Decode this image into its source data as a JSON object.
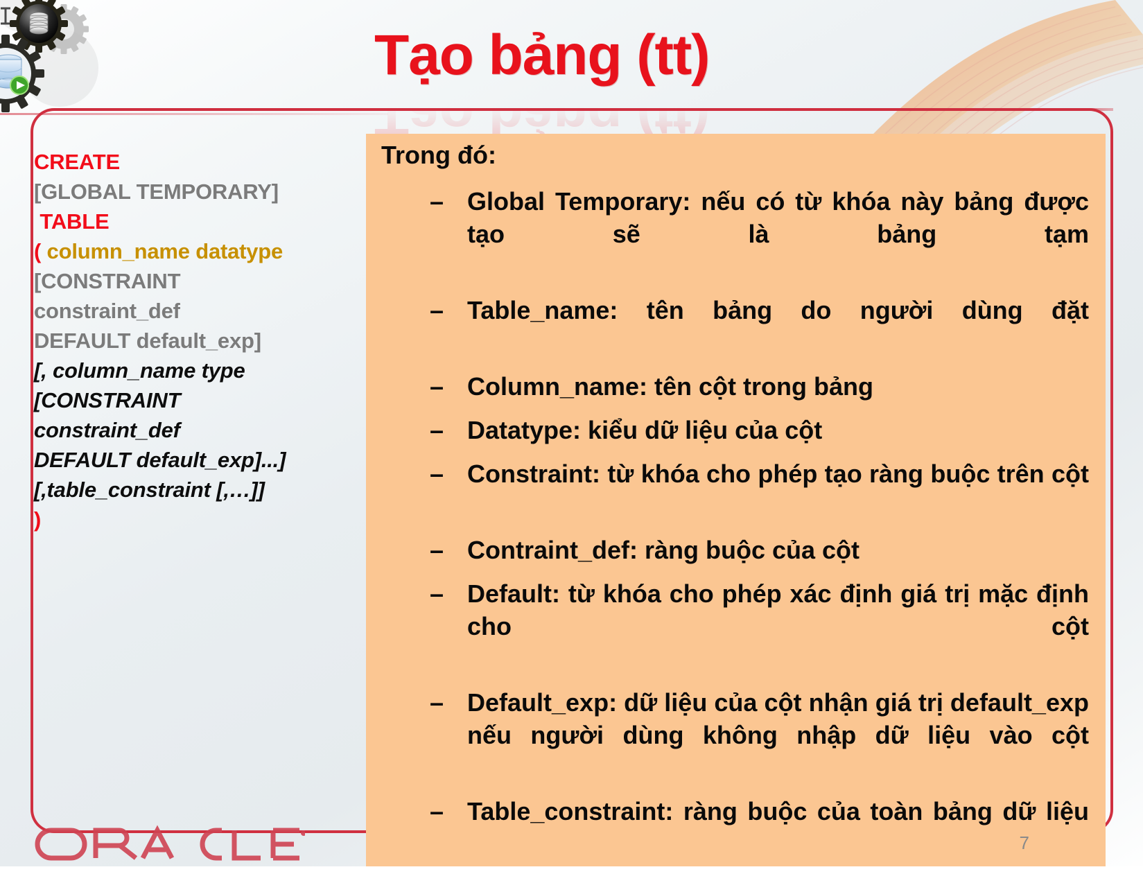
{
  "slide": {
    "title": "Tạo bảng (tt)",
    "page_number": "7",
    "brand_logo_text": "ORACLE",
    "colors": {
      "title_red": "#e8121c",
      "frame_red": "#d03040",
      "panel_orange": "#fbc692",
      "keyword_red": "#f20d1a",
      "optional_gray": "#7b7b7b",
      "identifier_gold": "#c79000",
      "body_black": "#0a0a0a",
      "page_number_gray": "#8a8a8a"
    }
  },
  "code_block": {
    "name": "create-table-syntax",
    "lines": [
      {
        "text": "CREATE",
        "style": "red"
      },
      {
        "text": "[GLOBAL TEMPORARY]",
        "style": "gray"
      },
      {
        "text": " TABLE",
        "style": "red"
      },
      {
        "text": "( ",
        "style": "red",
        "text2": "column_name datatype",
        "style2": "gold"
      },
      {
        "text": "[CONSTRAINT",
        "style": "gray"
      },
      {
        "text": "constraint_def",
        "style": "gray"
      },
      {
        "text": "DEFAULT default_exp]",
        "style": "gray"
      },
      {
        "text": "[, column_name type",
        "style": "italic"
      },
      {
        "text": "[CONSTRAINT",
        "style": "italic"
      },
      {
        "text": "constraint_def",
        "style": "italic"
      },
      {
        "text": "DEFAULT default_exp]...]",
        "style": "italic"
      },
      {
        "text": "[,table_constraint [,…]]",
        "style": "italic"
      },
      {
        "text": ")",
        "style": "red"
      }
    ]
  },
  "panel": {
    "heading": "Trong đó:",
    "bullet_marker": "–",
    "bullets": [
      {
        "text": "Global Temporary: nếu có từ khóa này bảng được tạo sẽ là bảng tạm",
        "justified": true
      },
      {
        "text": "Table_name: tên bảng do người dùng đặt",
        "justified": true
      },
      {
        "text": "Column_name: tên cột trong bảng",
        "justified": false
      },
      {
        "text": "Datatype: kiểu dữ liệu của cột",
        "justified": false
      },
      {
        "text": "Constraint: từ khóa cho phép tạo ràng buộc trên cột",
        "justified": true
      },
      {
        "text": "Contraint_def: ràng buộc của cột",
        "justified": false
      },
      {
        "text": "Default: từ khóa cho phép xác định giá trị mặc định cho cột",
        "justified": true
      },
      {
        "text": "Default_exp: dữ liệu của cột nhận giá trị default_exp nếu người dùng không nhập dữ liệu vào cột",
        "justified": true
      },
      {
        "text": "Table_constraint: ràng buộc của toàn bảng dữ liệu",
        "justified": true
      }
    ]
  },
  "decorations": {
    "gear_cluster": "gears-database-icon",
    "fan_swoosh": "fan-swoosh-decoration"
  }
}
